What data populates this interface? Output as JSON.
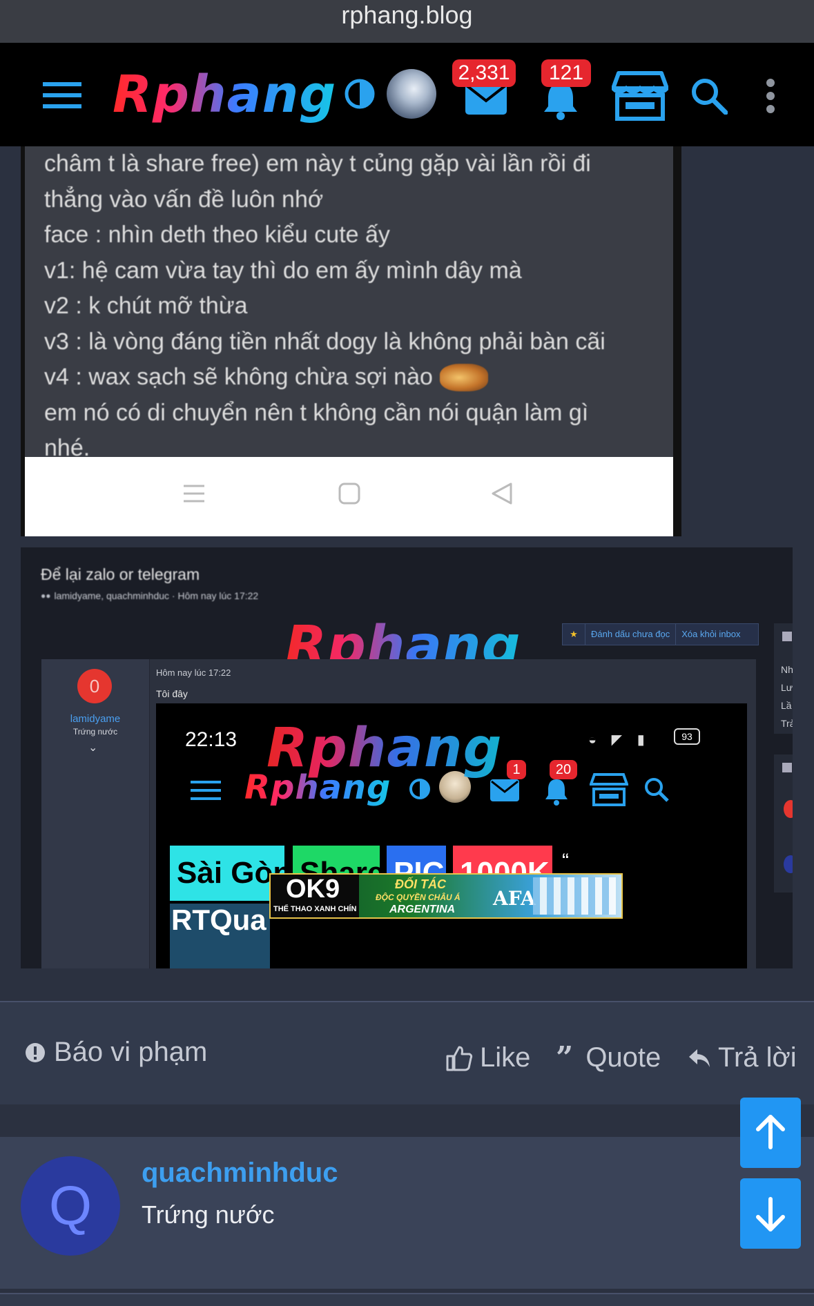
{
  "browser": {
    "url": "rphang.blog"
  },
  "header": {
    "logo_text": "Rphang",
    "inbox_count": "2,331",
    "alerts_count": "121",
    "icons": [
      "menu-icon",
      "theme-toggle-icon",
      "avatar",
      "envelope-icon",
      "bell-icon",
      "store-icon",
      "search-icon",
      "more-vertical-icon"
    ]
  },
  "post_image_1": {
    "lines": [
      "châm t là share free) em này t củng gặp vài lần rồi đi",
      "thẳng vào vấn đề luôn nhớ",
      "face : nhìn deth theo kiểu cute ấy",
      "v1: hệ cam vừa tay thì do em ấy mình dây mà",
      "v2 : k chút mỡ thừa",
      "v3 : là vòng đáng tiền nhất dogy là không phải bàn cãi",
      "v4 : wax sạch sẽ không chừa sợi nào",
      "em nó có di chuyển nên t không cần nói quận làm gì",
      "nhé."
    ]
  },
  "post_image_2": {
    "title": "Để lại zalo or telegram",
    "meta": "lamidyame, quachminhduc · Hôm nay lúc 17:22",
    "watermark": "Rphang",
    "btn_mark_unread": "Đánh dấu chưa đọc",
    "btn_remove_inbox": "Xóa khỏi inbox",
    "side_letters": [
      "Nh",
      "Lư",
      "Lầ",
      "Trả"
    ],
    "user_avatar_letter": "0",
    "username": "lamidyame",
    "user_title": "Trứng nước",
    "msg_time": "Hôm nay lúc 17:22",
    "msg_text": "Tôi đây",
    "phone": {
      "clock": "22:13",
      "battery": "93",
      "inbox_count": "1",
      "alerts_count": "20",
      "logo_text": "Rphang",
      "tags": [
        "Sài Gòn",
        "Share",
        "PIC",
        "1000K"
      ],
      "bottom_text": "RTQua",
      "ad_brand": "OK9",
      "ad_brand_sub": "THỂ THAO XANH CHÍN",
      "ad_partner": "ĐỐI TÁC",
      "ad_sub": "ĐỘC QUYỀN CHÂU Á",
      "ad_country": "ARGENTINA",
      "ad_logo": "AFA"
    }
  },
  "actions": {
    "report": "Báo vi phạm",
    "like": "Like",
    "quote": "Quote",
    "reply": "Trả lời"
  },
  "next_post": {
    "avatar_letter": "Q",
    "username": "quachminhduc",
    "user_title": "Trứng nước"
  },
  "colors": {
    "accent": "#2aa2ee",
    "badge": "#e6262e",
    "scroll_button": "#2196f3",
    "avatar_bg": "#2a3a9e"
  }
}
